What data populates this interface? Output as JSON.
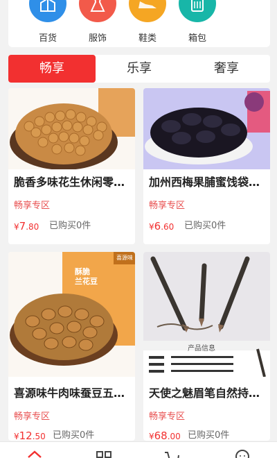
{
  "categories": [
    {
      "label": "百货",
      "icon": "gift-icon",
      "color": "#2f8fe8"
    },
    {
      "label": "服饰",
      "icon": "dress-icon",
      "color": "#f25a4a"
    },
    {
      "label": "鞋类",
      "icon": "shoe-icon",
      "color": "#f5a623"
    },
    {
      "label": "箱包",
      "icon": "luggage-icon",
      "color": "#18b6a8"
    }
  ],
  "tabs": [
    {
      "label": "畅享",
      "active": true
    },
    {
      "label": "乐享",
      "active": false
    },
    {
      "label": "奢享",
      "active": false
    }
  ],
  "products": [
    {
      "title": "脆香多味花生休闲零食坚果",
      "zone": "畅享专区",
      "currency": "¥",
      "price_int": "7",
      "price_dec": ".80",
      "sold": "已购买0件"
    },
    {
      "title": "加州西梅果脯蜜饯袋装零食",
      "zone": "畅享专区",
      "currency": "¥",
      "price_int": "6",
      "price_dec": ".60",
      "sold": "已购买0件"
    },
    {
      "title": "喜源味牛肉味蚕豆五香休闲",
      "zone": "畅享专区",
      "currency": "¥",
      "price_int": "12",
      "price_dec": ".50",
      "sold": "已购买0件",
      "package_lines": [
        "喜源味",
        "酥脆",
        "兰花豆"
      ]
    },
    {
      "title": "天使之魅眉笔自然持久防水",
      "zone": "畅享专区",
      "currency": "¥",
      "price_int": "68",
      "price_dec": ".00",
      "sold": "已购买0件",
      "info_label": "产品信息"
    }
  ],
  "bottom_nav": [
    {
      "icon": "home-icon",
      "active": true
    },
    {
      "icon": "category-icon",
      "active": false
    },
    {
      "icon": "cart-icon",
      "active": false
    },
    {
      "icon": "user-icon",
      "active": false
    }
  ],
  "colors": {
    "accent": "#f23030",
    "zone": "#e85050"
  }
}
